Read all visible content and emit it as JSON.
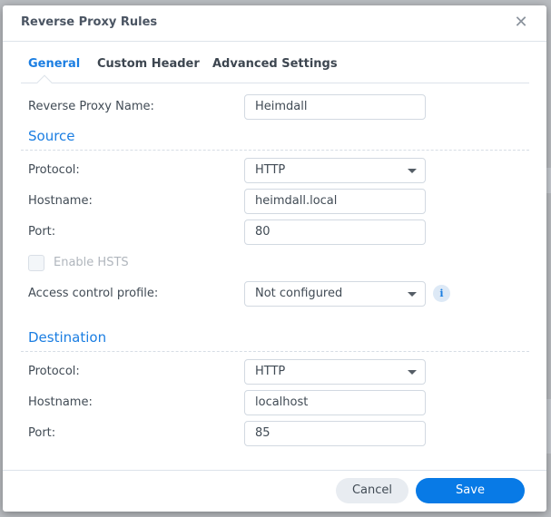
{
  "dialog": {
    "title": "Reverse Proxy Rules",
    "close_icon": "close-icon"
  },
  "tabs": [
    {
      "label": "General",
      "active": true
    },
    {
      "label": "Custom Header",
      "active": false
    },
    {
      "label": "Advanced Settings",
      "active": false
    }
  ],
  "general": {
    "name_label": "Reverse Proxy Name:",
    "name_value": "Heimdall"
  },
  "source": {
    "title": "Source",
    "protocol_label": "Protocol:",
    "protocol_value": "HTTP",
    "hostname_label": "Hostname:",
    "hostname_value": "heimdall.local",
    "port_label": "Port:",
    "port_value": "80",
    "hsts_label": "Enable HSTS",
    "hsts_checked": false,
    "hsts_disabled": true,
    "access_label": "Access control profile:",
    "access_value": "Not configured",
    "info_icon": "i"
  },
  "destination": {
    "title": "Destination",
    "protocol_label": "Protocol:",
    "protocol_value": "HTTP",
    "hostname_label": "Hostname:",
    "hostname_value": "localhost",
    "port_label": "Port:",
    "port_value": "85"
  },
  "footer": {
    "cancel_label": "Cancel",
    "save_label": "Save"
  },
  "colors": {
    "accent": "#1b7ee2",
    "primary_button": "#087ae6",
    "secondary_button": "#e8ecf1"
  }
}
